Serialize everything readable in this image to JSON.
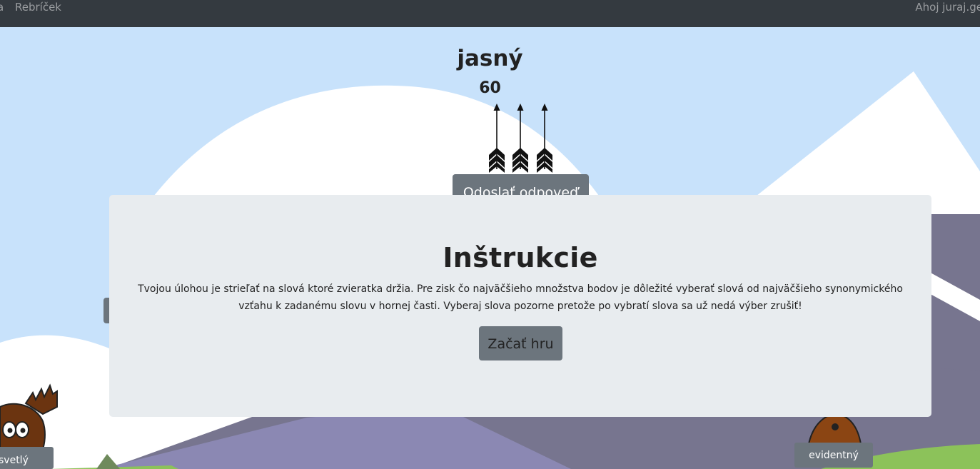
{
  "navbar": {
    "prev_fragment": "a",
    "ranking": "Rebríček",
    "greeting": "Ahoj juraj.ge"
  },
  "game": {
    "target_word": "jasný",
    "score": "60",
    "arrows_remaining": 3,
    "submit_label": "Odoslať odpoveď",
    "animal_words": [
      "svetlý",
      "evidentný"
    ]
  },
  "modal": {
    "title": "Inštrukcie",
    "text": "Tvojou úlohou je strieľať na slová ktoré zvieratka držia. Pre zisk čo najväčšieho množstva bodov je dôležité vyberať slová od najväčšieho synonymického vzťahu k zadanému slovu v hornej časti. Vyberaj slova pozorne pretože po vybratí slova sa už nedá výber zrušiť!",
    "start_label": "Začať hru"
  },
  "colors": {
    "navbar": "#343a40",
    "sky": "#c8e2fb",
    "button": "#6c757d",
    "modal": "#e8ecef"
  }
}
